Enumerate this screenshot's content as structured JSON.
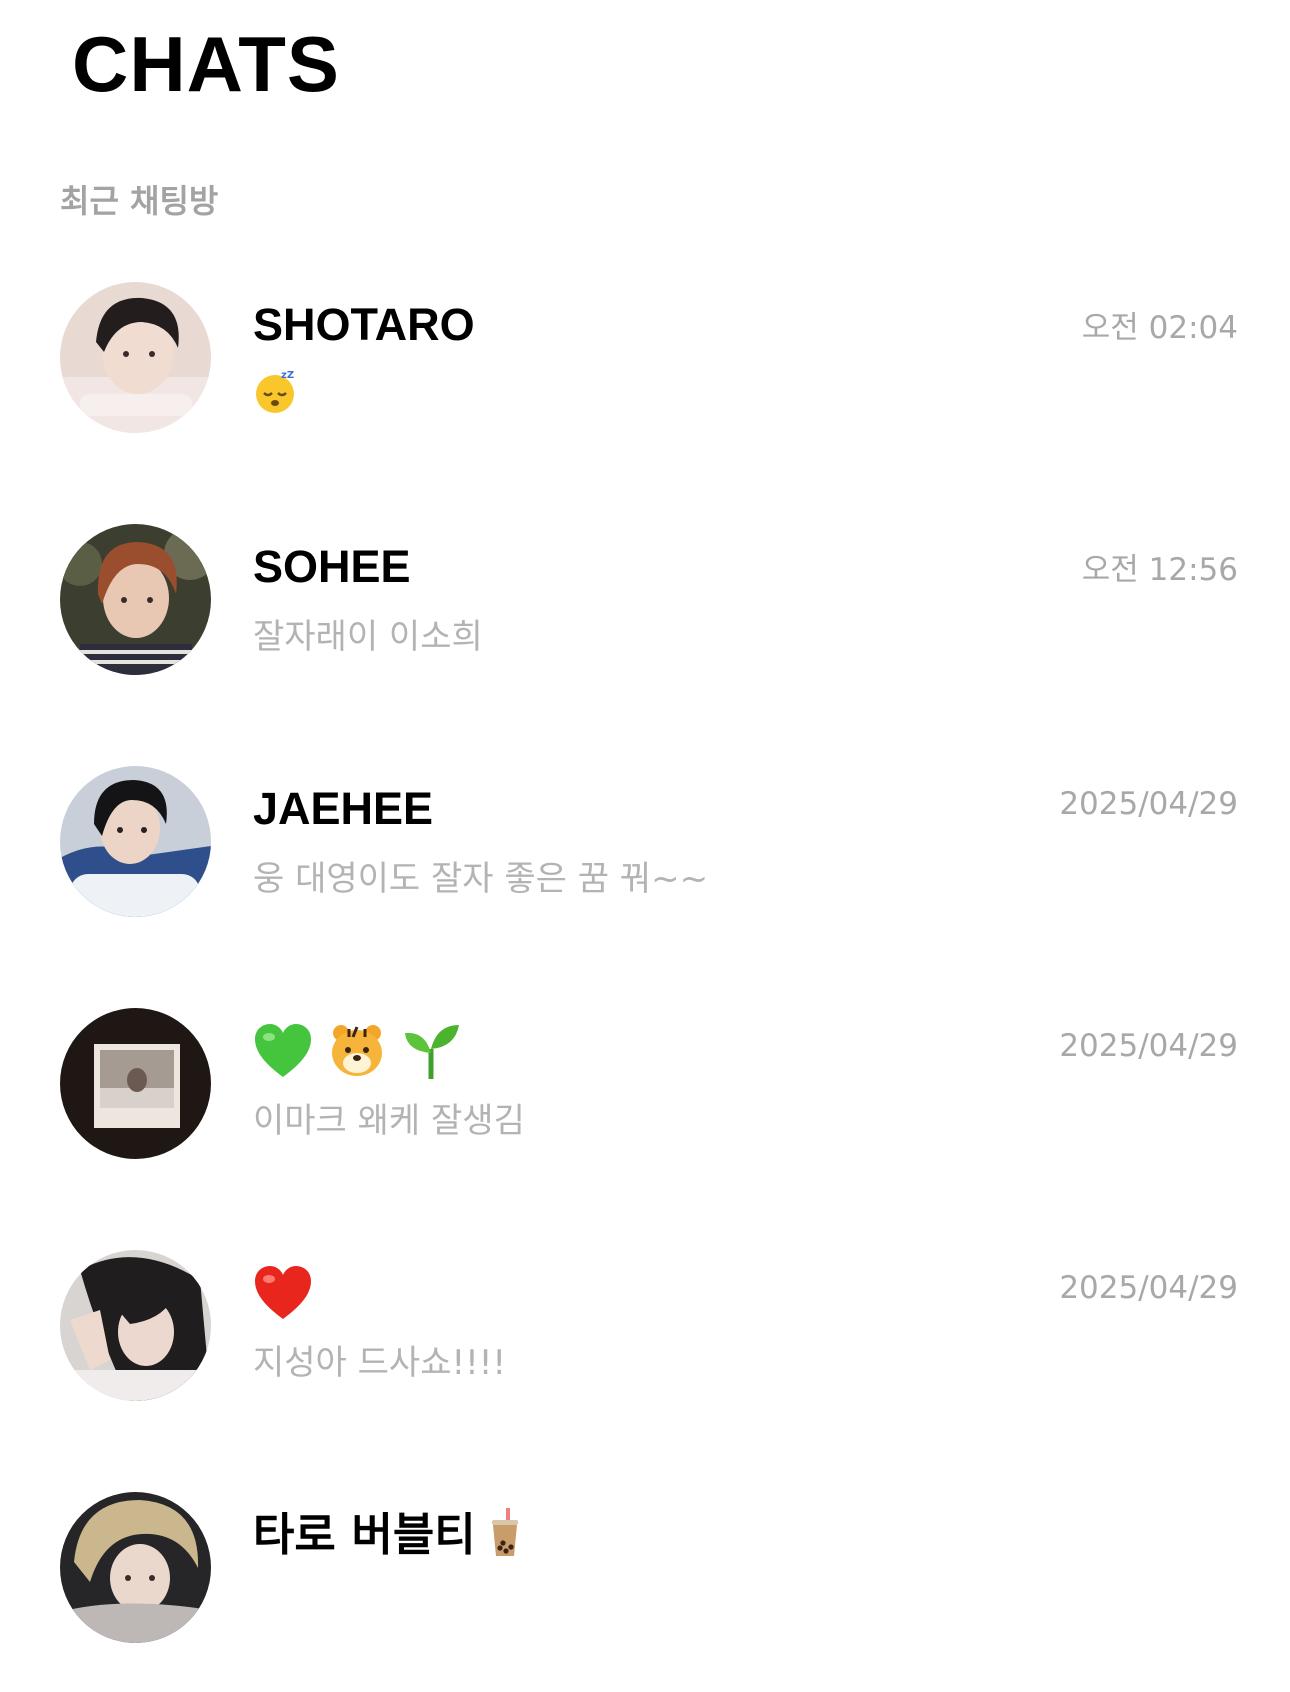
{
  "header": {
    "title": "CHATS",
    "section_label": "최근 채팅방"
  },
  "chats": [
    {
      "name": "SHOTARO",
      "preview": "",
      "preview_icon": "sleeping-face-icon",
      "time": "오전 02:04",
      "avatar": "avatar-photo"
    },
    {
      "name": "SOHEE",
      "preview": "잘자래이 이소희",
      "time": "오전 12:56",
      "avatar": "avatar-photo"
    },
    {
      "name": "JAEHEE",
      "preview": "웅 대영이도 잘자 좋은 꿈 꿔~~",
      "time": "2025/04/29",
      "avatar": "avatar-photo"
    },
    {
      "name": "",
      "name_icons": [
        "green-heart-icon",
        "tiger-face-icon",
        "seedling-icon"
      ],
      "preview": "이마크 왜케 잘생김",
      "time": "2025/04/29",
      "avatar": "avatar-polaroid-photo"
    },
    {
      "name": "",
      "name_icons": [
        "red-heart-icon"
      ],
      "preview": "지성아 드사쇼!!!!",
      "time": "2025/04/29",
      "avatar": "avatar-photo"
    },
    {
      "name": "타로 버블티",
      "name_icon": "bubble-tea-icon",
      "preview": "",
      "time": "",
      "avatar": "avatar-photo"
    }
  ],
  "colors": {
    "background": "#ffffff",
    "title": "#000000",
    "secondary_text": "#a8a8a8"
  }
}
